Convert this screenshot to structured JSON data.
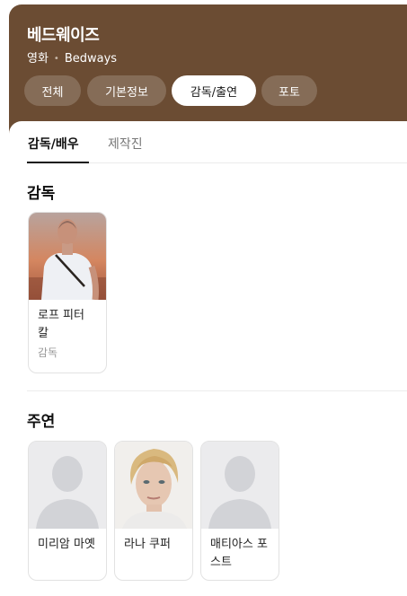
{
  "header": {
    "title": "베드웨이즈",
    "subtitle_type": "영화",
    "subtitle_original": "Bedways",
    "tabs": [
      {
        "label": "전체",
        "active": false
      },
      {
        "label": "기본정보",
        "active": false
      },
      {
        "label": "감독/출연",
        "active": true
      },
      {
        "label": "포토",
        "active": false
      }
    ]
  },
  "subtabs": [
    {
      "label": "감독/배우",
      "active": true
    },
    {
      "label": "제작진",
      "active": false
    }
  ],
  "director_section": {
    "title": "감독",
    "people": [
      {
        "name": "로프 피터 칼",
        "role": "감독",
        "photo": "director-photo"
      }
    ]
  },
  "cast_section": {
    "title": "주연",
    "people": [
      {
        "name": "미리암 마옛",
        "photo": "placeholder-person-icon"
      },
      {
        "name": "라나 쿠퍼",
        "photo": "actress-photo"
      },
      {
        "name": "매티아스 포스트",
        "photo": "placeholder-person-icon"
      }
    ]
  },
  "colors": {
    "header_bg": "#6b4c33",
    "active_pill_bg": "#ffffff",
    "placeholder_bg": "#ebebed"
  }
}
